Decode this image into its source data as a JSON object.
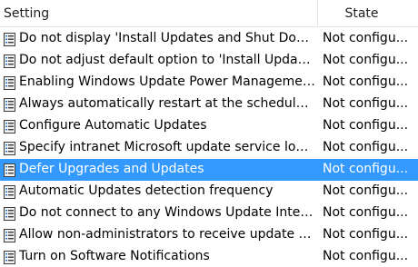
{
  "header": {
    "setting": "Setting",
    "state": "State"
  },
  "colors": {
    "selection": "#3399ff",
    "icon_fill": "#f2f2f2",
    "icon_line": "#3a3a3a",
    "icon_accent": "#1f6fc5"
  },
  "rows": [
    {
      "name": "Do not display 'Install Updates and Shut Down' ...",
      "state": "Not configu...",
      "icon": "policy-setting-icon"
    },
    {
      "name": "Do not adjust default option to 'Install Updates ...",
      "state": "Not configu...",
      "icon": "policy-setting-icon"
    },
    {
      "name": "Enabling Windows Update Power Management ...",
      "state": "Not configu...",
      "icon": "policy-setting-icon"
    },
    {
      "name": "Always automatically restart at the scheduled ti...",
      "state": "Not configu...",
      "icon": "policy-setting-icon"
    },
    {
      "name": "Configure Automatic Updates",
      "state": "Not configu...",
      "icon": "policy-setting-icon"
    },
    {
      "name": "Specify intranet Microsoft update service locati...",
      "state": "Not configu...",
      "icon": "policy-setting-icon"
    },
    {
      "name": "Defer Upgrades and Updates",
      "state": "Not configu...",
      "icon": "policy-setting-icon",
      "selected": true
    },
    {
      "name": "Automatic Updates detection frequency",
      "state": "Not configu...",
      "icon": "policy-setting-icon"
    },
    {
      "name": "Do not connect to any Windows Update Interne...",
      "state": "Not configu...",
      "icon": "policy-setting-icon"
    },
    {
      "name": "Allow non-administrators to receive update not...",
      "state": "Not configu...",
      "icon": "policy-setting-icon"
    },
    {
      "name": "Turn on Software Notifications",
      "state": "Not configu...",
      "icon": "policy-setting-icon"
    }
  ]
}
